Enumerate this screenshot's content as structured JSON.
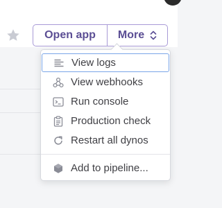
{
  "header": {
    "open_app_label": "Open app",
    "more_label": "More",
    "star_icon": "star-icon",
    "chevron_icon": "chevron-up-down-icon"
  },
  "menu": {
    "items": [
      {
        "label": "View logs",
        "icon": "logs-icon"
      },
      {
        "label": "View webhooks",
        "icon": "webhooks-icon"
      },
      {
        "label": "Run console",
        "icon": "console-icon"
      },
      {
        "label": "Production check",
        "icon": "clipboard-check-icon"
      },
      {
        "label": "Restart all dynos",
        "icon": "restart-icon"
      },
      {
        "label": "Add to pipeline...",
        "icon": "pipeline-icon"
      }
    ]
  },
  "colors": {
    "accent": "#5b4e94",
    "border": "#a89ad6",
    "focus": "#79a5e8"
  }
}
